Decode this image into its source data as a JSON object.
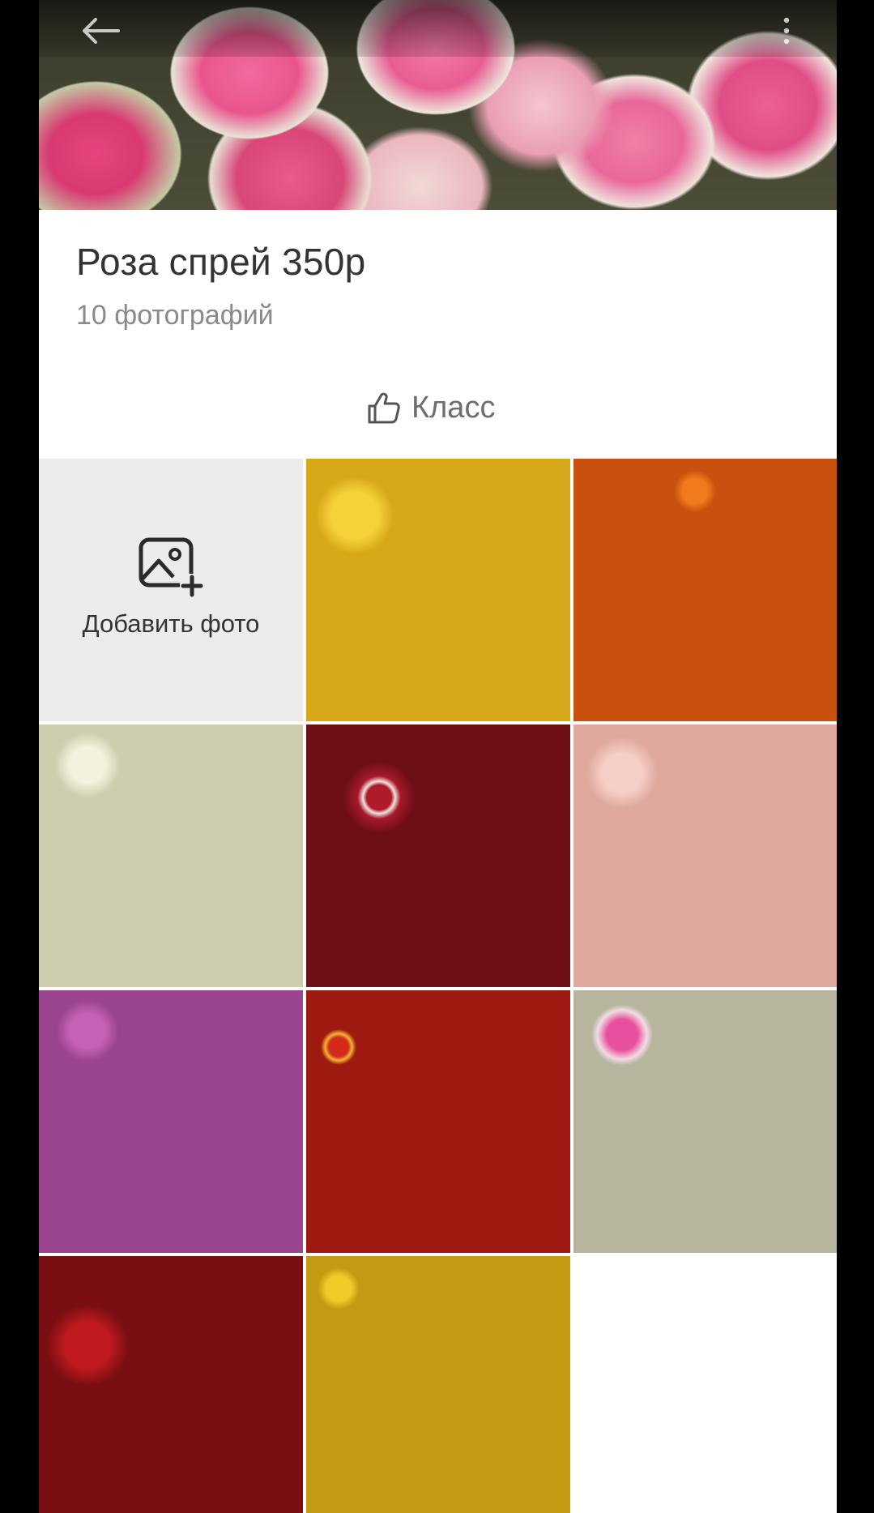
{
  "colors": {
    "background": "#ffffff",
    "title_text": "#333333",
    "secondary_text": "#8a8a8a",
    "add_tile_bg": "#eeeceb"
  },
  "header": {
    "back_icon": "arrow-left-icon",
    "menu_icon": "more-vertical-icon"
  },
  "album": {
    "title": "Роза спрей 350р",
    "photo_count": "10 фотографий",
    "like_label": "Класс",
    "like_icon": "thumbs-up-icon"
  },
  "grid": {
    "add_photo_label": "Добавить фото",
    "add_photo_icon": "add-image-icon",
    "photos": [
      {
        "subject": "yellow spray roses"
      },
      {
        "subject": "orange spray roses"
      },
      {
        "subject": "white spray roses"
      },
      {
        "subject": "red and white striped spray roses"
      },
      {
        "subject": "pale pink spray roses"
      },
      {
        "subject": "lilac spray roses"
      },
      {
        "subject": "red and yellow spray roses"
      },
      {
        "subject": "pink and white spray roses"
      },
      {
        "subject": "red spray roses"
      },
      {
        "subject": "yellow spray roses"
      }
    ]
  }
}
